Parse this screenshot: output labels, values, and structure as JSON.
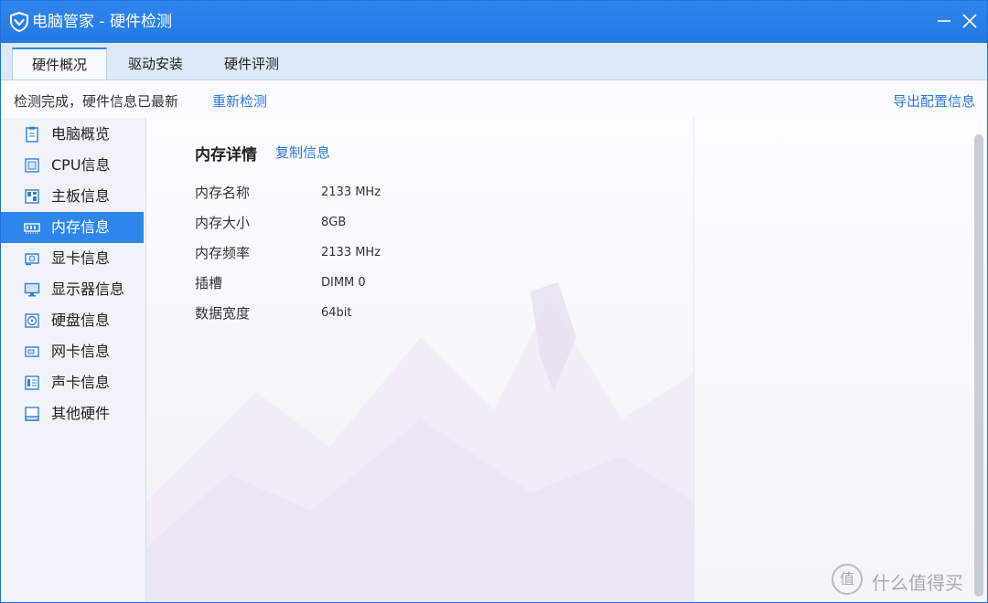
{
  "window": {
    "title": "电脑管家 - 硬件检测",
    "accent_color": "#2e86ec",
    "logo_icon": "shield-icon",
    "minimize_icon": "minimize-icon",
    "close_icon": "close-icon"
  },
  "tabs": [
    {
      "label": "硬件概况",
      "active": true
    },
    {
      "label": "驱动安装",
      "active": false
    },
    {
      "label": "硬件评测",
      "active": false
    }
  ],
  "status": {
    "text": "检测完成，硬件信息已最新",
    "recheck_label": "重新检测",
    "export_label": "导出配置信息"
  },
  "sidebar": {
    "items": [
      {
        "label": "电脑概览",
        "icon": "overview-icon",
        "active": false
      },
      {
        "label": "CPU信息",
        "icon": "cpu-icon",
        "active": false
      },
      {
        "label": "主板信息",
        "icon": "motherboard-icon",
        "active": false
      },
      {
        "label": "内存信息",
        "icon": "memory-icon",
        "active": true
      },
      {
        "label": "显卡信息",
        "icon": "graphics-card-icon",
        "active": false
      },
      {
        "label": "显示器信息",
        "icon": "monitor-icon",
        "active": false
      },
      {
        "label": "硬盘信息",
        "icon": "hard-disk-icon",
        "active": false
      },
      {
        "label": "网卡信息",
        "icon": "network-card-icon",
        "active": false
      },
      {
        "label": "声卡信息",
        "icon": "sound-card-icon",
        "active": false
      },
      {
        "label": "其他硬件",
        "icon": "other-hardware-icon",
        "active": false
      }
    ]
  },
  "detail": {
    "title": "内存详情",
    "copy_label": "复制信息",
    "rows": [
      {
        "key": "内存名称",
        "value": "2133 MHz"
      },
      {
        "key": "内存大小",
        "value": "8GB"
      },
      {
        "key": "内存频率",
        "value": "2133 MHz"
      },
      {
        "key": "插槽",
        "value": "DIMM 0"
      },
      {
        "key": "数据宽度",
        "value": "64bit"
      }
    ]
  },
  "watermark": {
    "mark": "值",
    "text": "什么值得买"
  }
}
